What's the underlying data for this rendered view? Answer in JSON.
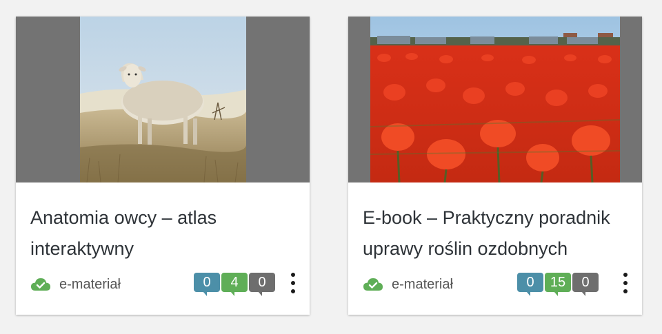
{
  "cards": [
    {
      "title": "Anatomia owcy – atlas interaktywny",
      "type_label": "e-materiał",
      "type_icon": "cloud-check-icon",
      "counts": {
        "blue": "0",
        "green": "4",
        "grey": "0"
      }
    },
    {
      "title": "E-book – Praktyczny poradnik uprawy roślin ozdobnych",
      "type_label": "e-materiał",
      "type_icon": "cloud-check-icon",
      "counts": {
        "blue": "0",
        "green": "15",
        "grey": "0"
      }
    }
  ],
  "colors": {
    "badge_blue": "#4c8fa8",
    "badge_green": "#5fae57",
    "badge_grey": "#6e6e6e",
    "cloud_icon": "#5fae57",
    "thumb_bg": "#737373"
  }
}
